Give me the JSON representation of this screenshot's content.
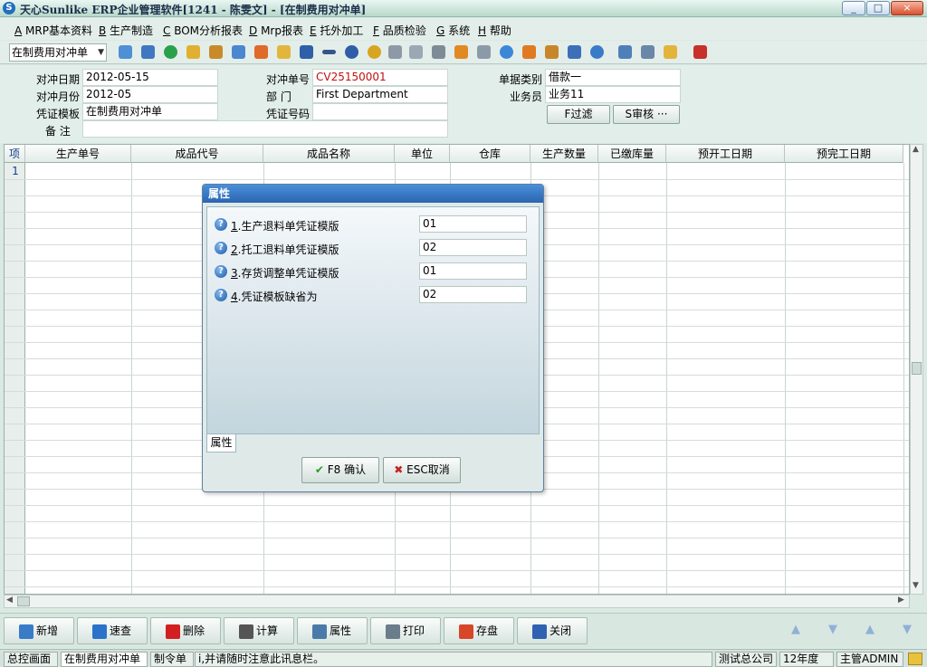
{
  "window": {
    "title": "天心Sunlike ERP企业管理软件[1241 - 陈雯文] - [在制费用对冲单]",
    "app_icon": "sunlike-logo-icon",
    "controls": [
      "_",
      "□",
      "×"
    ]
  },
  "menu": [
    {
      "key": "A",
      "label": " MRP基本资料"
    },
    {
      "key": "B",
      "label": " 生产制造"
    },
    {
      "key": "C",
      "label": " BOM分析报表"
    },
    {
      "key": "D",
      "label": " Mrp报表"
    },
    {
      "key": "E",
      "label": " 托外加工"
    },
    {
      "key": "F",
      "label": " 品质检验"
    },
    {
      "key": "G",
      "label": " 系统"
    },
    {
      "key": "H",
      "label": " 帮助"
    }
  ],
  "toolbar": {
    "combo_value": "在制费用对冲单"
  },
  "form": {
    "date_label": "对冲日期",
    "date_value": "2012-05-15",
    "month_label": "对冲月份",
    "month_value": "2012-05",
    "template_label": "凭证模板",
    "template_value": "在制费用对冲单",
    "note_label": "备    注",
    "note_value": "",
    "no_label": "对冲单号",
    "no_value": "CV25150001",
    "dept_label": "部      门",
    "dept_value": "First Department",
    "voucher_label": "凭证号码",
    "voucher_value": "",
    "type_label": "单据类别",
    "type_value": "借款一",
    "staff_label": "业务员",
    "staff_value": "业务11",
    "filter_button": "F过滤",
    "audit_button": "S审核 ···"
  },
  "grid": {
    "headers": [
      "项",
      "生产单号",
      "成品代号",
      "成品名称",
      "单位",
      "仓库",
      "生产数量",
      "已缴库量",
      "预开工日期",
      "预完工日期"
    ],
    "first_row_num": "1"
  },
  "dialog": {
    "title": "属性",
    "rows": [
      {
        "num": "1",
        "label": ".生产退料单凭证模版",
        "value": "01"
      },
      {
        "num": "2",
        "label": ".托工退料单凭证模版",
        "value": "02"
      },
      {
        "num": "3",
        "label": ".存货调整单凭证模版",
        "value": "01"
      },
      {
        "num": "4",
        "label": ".凭证模板缺省为",
        "value": "02"
      }
    ],
    "tab_label": "属性",
    "ok_button": "F8 确认",
    "cancel_button": "ESC取消"
  },
  "bottom_buttons": [
    {
      "label": "新增",
      "icon": "add-icon",
      "color": "#3a7bc8"
    },
    {
      "label": "速查",
      "icon": "search-icon",
      "color": "#2b73c9"
    },
    {
      "label": "删除",
      "icon": "delete-icon",
      "color": "#d21f1f"
    },
    {
      "label": "计算",
      "icon": "calculate-icon",
      "color": "#555555"
    },
    {
      "label": "属性",
      "icon": "properties-icon",
      "color": "#4a7aa8"
    },
    {
      "label": "打印",
      "icon": "print-icon",
      "color": "#6b7d8a"
    },
    {
      "label": "存盘",
      "icon": "save-icon",
      "color": "#d8462a"
    },
    {
      "label": "关闭",
      "icon": "close-icon",
      "color": "#2f62b0"
    }
  ],
  "status": {
    "cells": [
      "总控画面",
      "在制费用对冲单",
      "制令单",
      "i,并请随时注意此讯息栏。",
      "测试总公司",
      "12年度",
      "主管ADMIN"
    ]
  }
}
